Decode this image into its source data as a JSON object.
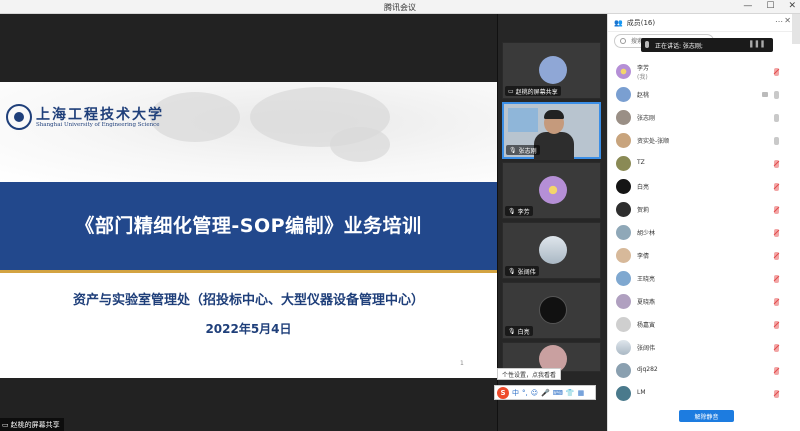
{
  "window": {
    "title": "腾讯会议",
    "minimize": "—",
    "maximize": "☐",
    "close": "✕"
  },
  "slide": {
    "university_cn": "上海工程技术大学",
    "university_en": "Shanghai University of Engineering Science",
    "title": "《部门精细化管理-SOP编制》业务培训",
    "subtitle": "资产与实验室管理处（招投标中心、大型仪器设备管理中心）",
    "date": "2022年5月4日",
    "page_number": "1"
  },
  "share_label": "赵桃的屏幕共享",
  "video_tiles": [
    {
      "name": "赵桃的屏幕共享",
      "avatar_color": "#8fa7d6"
    },
    {
      "name": "张志刚",
      "active": true
    },
    {
      "name": "李芳",
      "avatar_color": "#b58fd6"
    },
    {
      "name": "张阔伟",
      "avatar_color": "#c7d1db"
    },
    {
      "name": "白亮",
      "avatar_color": "#111111"
    }
  ],
  "ime": {
    "tip": "个性设置，点我看看",
    "logo": "S",
    "mode": "中"
  },
  "panel": {
    "header": "成员(16)",
    "more": "⋯",
    "close": "✕",
    "search_placeholder": "搜索",
    "speaking": "正在讲话: 张志刚;",
    "members": [
      {
        "name": "李芳",
        "sub": "(我)",
        "avatar_color": "#b58fd6",
        "muted": true
      },
      {
        "name": "赵桃",
        "avatar_color": "#7a9fd1",
        "muted": false,
        "camera": true
      },
      {
        "name": "张志刚",
        "avatar_color": "#9a8f86",
        "muted": false
      },
      {
        "name": "资实处-张顺",
        "avatar_color": "#c8a47d",
        "muted": false
      },
      {
        "name": "TZ",
        "avatar_color": "#8a8a55",
        "muted": true
      },
      {
        "name": "白亮",
        "avatar_color": "#151515",
        "muted": true
      },
      {
        "name": "贺莉",
        "avatar_color": "#2e2e2e",
        "muted": true
      },
      {
        "name": "胡少林",
        "avatar_color": "#8fa8b8",
        "muted": true
      },
      {
        "name": "李倩",
        "avatar_color": "#d7b99a",
        "muted": true
      },
      {
        "name": "王晓亮",
        "avatar_color": "#7fa8d0",
        "muted": true
      },
      {
        "name": "夏晓燕",
        "avatar_color": "#b0a0c0",
        "muted": true
      },
      {
        "name": "杨嘉寅",
        "avatar_color": "#cfcfcf",
        "muted": true
      },
      {
        "name": "张阔伟",
        "avatar_color": "#c7d1db",
        "muted": true
      },
      {
        "name": "djq282",
        "avatar_color": "#8aa0b0",
        "muted": true
      },
      {
        "name": "LM",
        "avatar_color": "#4a7a8c",
        "muted": true
      }
    ],
    "unmute_all": "解除静音"
  }
}
